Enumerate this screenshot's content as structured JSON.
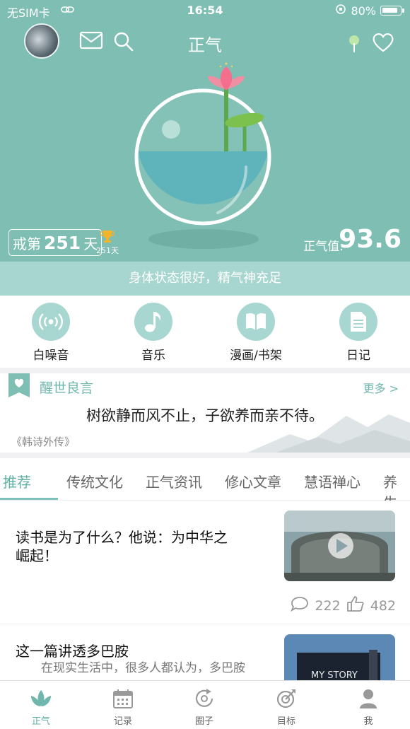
{
  "status_bar": {
    "carrier": "无SIM卡",
    "time": "16:54",
    "battery": "80%"
  },
  "header": {
    "title": "正气"
  },
  "hero": {
    "day_prefix": "戒第",
    "day_count": "251",
    "day_suffix": "天",
    "trophy_days": "251天",
    "zhengqi_label": "正气值:",
    "zhengqi_value": "93.6",
    "state_text": "身体状态很好，精气神充足"
  },
  "shortcuts": [
    {
      "label": "白噪音",
      "icon": "radio-waves-icon"
    },
    {
      "label": "音乐",
      "icon": "music-note-icon"
    },
    {
      "label": "漫画/书架",
      "icon": "open-book-icon"
    },
    {
      "label": "日记",
      "icon": "document-icon"
    }
  ],
  "quote": {
    "title": "醒世良言",
    "more": "更多 >",
    "text": "树欲静而风不止，子欲养而亲不待。",
    "source": "《韩诗外传》"
  },
  "tabs": [
    "推荐",
    "传统文化",
    "正气资讯",
    "修心文章",
    "慧语禅心",
    "养生"
  ],
  "articles": [
    {
      "title_line1": "读书是为了什么？他说：为中华之",
      "title_line2": "崛起！",
      "comments": "222",
      "likes": "482"
    },
    {
      "title_line1": "这一篇讲透多巴胺",
      "summary": "在现实生活中，很多人都认为，多巴胺"
    }
  ],
  "bottom_nav": [
    {
      "label": "正气",
      "icon": "lotus-icon"
    },
    {
      "label": "记录",
      "icon": "calendar-icon"
    },
    {
      "label": "圈子",
      "icon": "circle-refresh-icon"
    },
    {
      "label": "目标",
      "icon": "target-icon"
    },
    {
      "label": "我",
      "icon": "person-icon"
    }
  ],
  "colors": {
    "primary": "#7ebeb3",
    "accent": "#5fb0a4"
  }
}
